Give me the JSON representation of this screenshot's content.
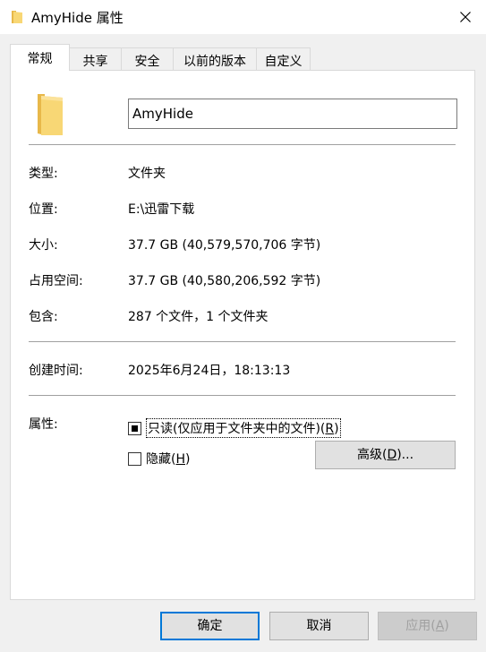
{
  "window": {
    "title": "AmyHide 属性"
  },
  "tabs": [
    {
      "label": "常规"
    },
    {
      "label": "共享"
    },
    {
      "label": "安全"
    },
    {
      "label": "以前的版本"
    },
    {
      "label": "自定义"
    }
  ],
  "general": {
    "name_value": "AmyHide",
    "type_label": "类型:",
    "type_value": "文件夹",
    "location_label": "位置:",
    "location_value": "E:\\迅雷下载",
    "size_label": "大小:",
    "size_value": "37.7 GB (40,579,570,706 字节)",
    "disk_label": "占用空间:",
    "disk_value": "37.7 GB (40,580,206,592 字节)",
    "contains_label": "包含:",
    "contains_value": "287 个文件，1 个文件夹",
    "created_label": "创建时间:",
    "created_value": "2025年6月24日，18:13:13",
    "attributes_label": "属性:",
    "readonly_text": "只读(仅应用于文件夹中的文件)(",
    "readonly_key": "R",
    "readonly_close": ")",
    "hidden_text": "隐藏(",
    "hidden_key": "H",
    "hidden_close": ")",
    "advanced_text": "高级(",
    "advanced_key": "D",
    "advanced_close": ")..."
  },
  "footer": {
    "ok": "确定",
    "cancel": "取消",
    "apply_text": "应用(",
    "apply_key": "A",
    "apply_close": ")"
  },
  "colors": {
    "folder": "#f8d775",
    "folder_dark": "#e8b84a",
    "accent": "#0078d7"
  }
}
